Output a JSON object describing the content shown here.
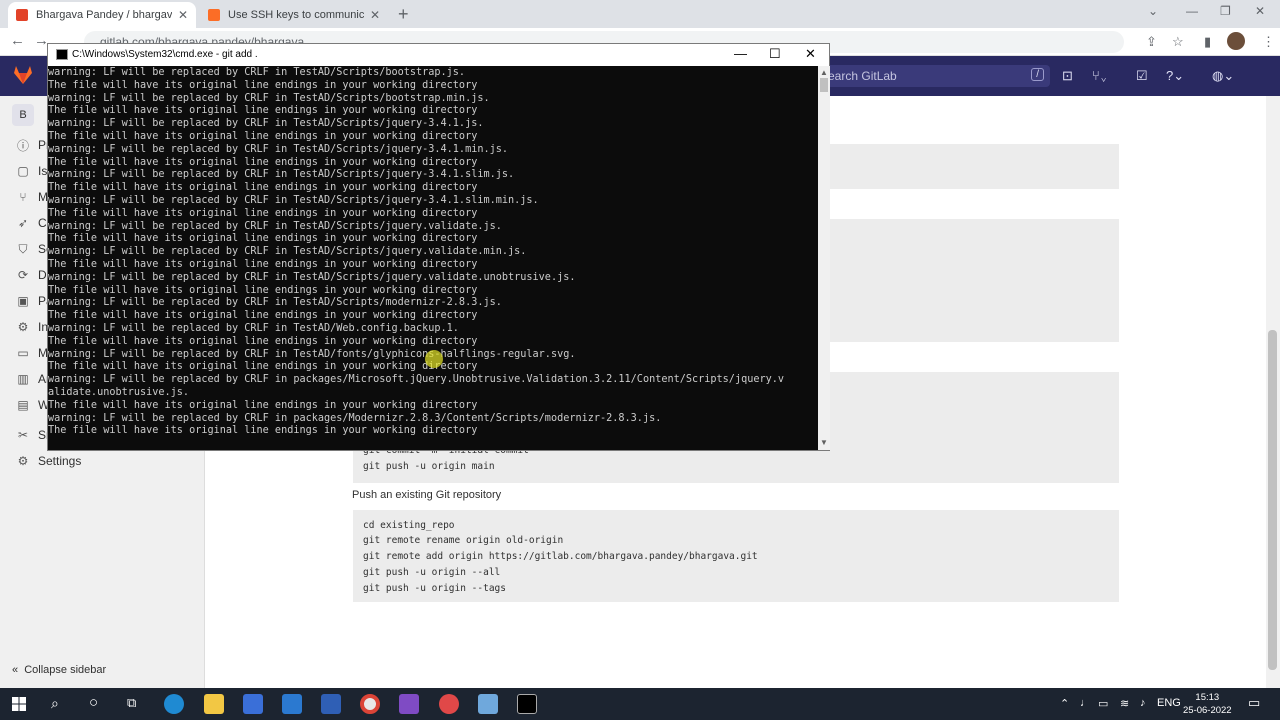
{
  "browser": {
    "tabs": [
      {
        "title": "Bhargava Pandey / bhargava · Gi",
        "close": "✕"
      },
      {
        "title": "Use SSH keys to communicate w",
        "close": "✕"
      }
    ],
    "new_tab": "+",
    "url": "gitlab.com/bhargava.pandey/bhargava"
  },
  "gitlab": {
    "search_placeholder": "Search GitLab",
    "search_shortcut": "/",
    "project_initial": "B",
    "sidebar": [
      {
        "label": "Pr",
        "icon": "project-info-icon"
      },
      {
        "label": "Iss",
        "icon": "issues-icon"
      },
      {
        "label": "M",
        "icon": "merge-requests-icon"
      },
      {
        "label": "Cl",
        "icon": "ci-cd-icon"
      },
      {
        "label": "Se",
        "icon": "security-icon"
      },
      {
        "label": "De",
        "icon": "deployments-icon"
      },
      {
        "label": "Pa",
        "icon": "packages-icon"
      },
      {
        "label": "In",
        "icon": "infrastructure-icon"
      },
      {
        "label": "M",
        "icon": "monitor-icon"
      },
      {
        "label": "An",
        "icon": "analytics-icon"
      },
      {
        "label": "W",
        "icon": "wiki-icon"
      },
      {
        "label": "Sn",
        "icon": "snippets-icon"
      },
      {
        "label": "Settings",
        "icon": "settings-icon"
      }
    ],
    "collapse_label": "Collapse sidebar",
    "partial_code": [
      "git commit -m \"initial commit\"",
      "git push -u origin main"
    ],
    "push_existing_heading": "Push an existing Git repository",
    "push_existing_code": [
      "cd existing_repo",
      "git remote rename origin old-origin",
      "git remote add origin https://gitlab.com/bhargava.pandey/bhargava.git",
      "git push -u origin --all",
      "git push -u origin --tags"
    ]
  },
  "cmd": {
    "title": "C:\\Windows\\System32\\cmd.exe - git  add .",
    "lines": [
      "warning: LF will be replaced by CRLF in TestAD/Scripts/bootstrap.js.",
      "The file will have its original line endings in your working directory",
      "warning: LF will be replaced by CRLF in TestAD/Scripts/bootstrap.min.js.",
      "The file will have its original line endings in your working directory",
      "warning: LF will be replaced by CRLF in TestAD/Scripts/jquery-3.4.1.js.",
      "The file will have its original line endings in your working directory",
      "warning: LF will be replaced by CRLF in TestAD/Scripts/jquery-3.4.1.min.js.",
      "The file will have its original line endings in your working directory",
      "warning: LF will be replaced by CRLF in TestAD/Scripts/jquery-3.4.1.slim.js.",
      "The file will have its original line endings in your working directory",
      "warning: LF will be replaced by CRLF in TestAD/Scripts/jquery-3.4.1.slim.min.js.",
      "The file will have its original line endings in your working directory",
      "warning: LF will be replaced by CRLF in TestAD/Scripts/jquery.validate.js.",
      "The file will have its original line endings in your working directory",
      "warning: LF will be replaced by CRLF in TestAD/Scripts/jquery.validate.min.js.",
      "The file will have its original line endings in your working directory",
      "warning: LF will be replaced by CRLF in TestAD/Scripts/jquery.validate.unobtrusive.js.",
      "The file will have its original line endings in your working directory",
      "warning: LF will be replaced by CRLF in TestAD/Scripts/modernizr-2.8.3.js.",
      "The file will have its original line endings in your working directory",
      "warning: LF will be replaced by CRLF in TestAD/Web.config.backup.1.",
      "The file will have its original line endings in your working directory",
      "warning: LF will be replaced by CRLF in TestAD/fonts/glyphicons-halflings-regular.svg.",
      "The file will have its original line endings in your working directory",
      "warning: LF will be replaced by CRLF in packages/Microsoft.jQuery.Unobtrusive.Validation.3.2.11/Content/Scripts/jquery.v",
      "alidate.unobtrusive.js.",
      "The file will have its original line endings in your working directory",
      "warning: LF will be replaced by CRLF in packages/Modernizr.2.8.3/Content/Scripts/modernizr-2.8.3.js.",
      "The file will have its original line endings in your working directory"
    ]
  },
  "taskbar": {
    "lang": "ENG",
    "time": "15:13",
    "date": "25-06-2022"
  }
}
